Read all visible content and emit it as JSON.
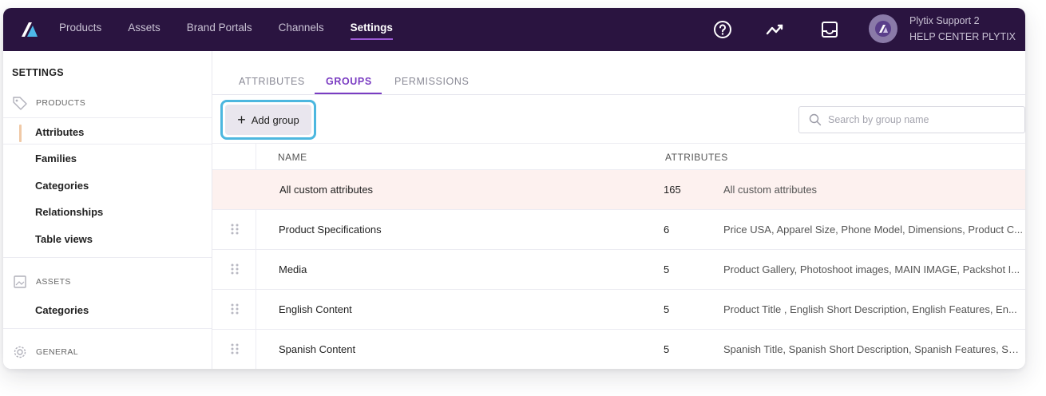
{
  "topbar": {
    "nav": [
      "Products",
      "Assets",
      "Brand Portals",
      "Channels",
      "Settings"
    ],
    "active_nav": "Settings",
    "user_name": "Plytix Support 2",
    "user_org": "HELP CENTER PLYTIX",
    "icons": [
      "plytix-logo-icon",
      "help-icon",
      "activity-icon",
      "inbox-icon",
      "avatar"
    ]
  },
  "sidebar": {
    "title": "SETTINGS",
    "sections": {
      "products": "PRODUCTS",
      "assets": "ASSETS",
      "general": "GENERAL"
    },
    "product_items": [
      "Attributes",
      "Families",
      "Categories",
      "Relationships",
      "Table views"
    ],
    "asset_items": [
      "Categories"
    ],
    "active_item": "Attributes"
  },
  "tabs": [
    "ATTRIBUTES",
    "GROUPS",
    "PERMISSIONS"
  ],
  "active_tab": "GROUPS",
  "toolbar": {
    "add_label": "Add group",
    "search_placeholder": "Search by group name"
  },
  "table": {
    "columns": [
      "NAME",
      "ATTRIBUTES"
    ],
    "rows": [
      {
        "name": "All custom attributes",
        "count": "165",
        "attributes": "All custom attributes"
      },
      {
        "name": "Product Specifications",
        "count": "6",
        "attributes": "Price USA, Apparel Size, Phone Model, Dimensions, Product C..."
      },
      {
        "name": "Media",
        "count": "5",
        "attributes": "Product Gallery, Photoshoot images, MAIN IMAGE, Packshot I..."
      },
      {
        "name": "English Content",
        "count": "5",
        "attributes": "Product Title , English Short Description, English Features, En..."
      },
      {
        "name": "Spanish Content",
        "count": "5",
        "attributes": "Spanish Title, Spanish Short Description, Spanish Features, Sp..."
      }
    ]
  },
  "colors": {
    "topbar_bg": "#2a1440",
    "accent": "#7a3cc2",
    "highlight_border": "#4cb7df",
    "highlight_row": "#fdf1ef"
  }
}
